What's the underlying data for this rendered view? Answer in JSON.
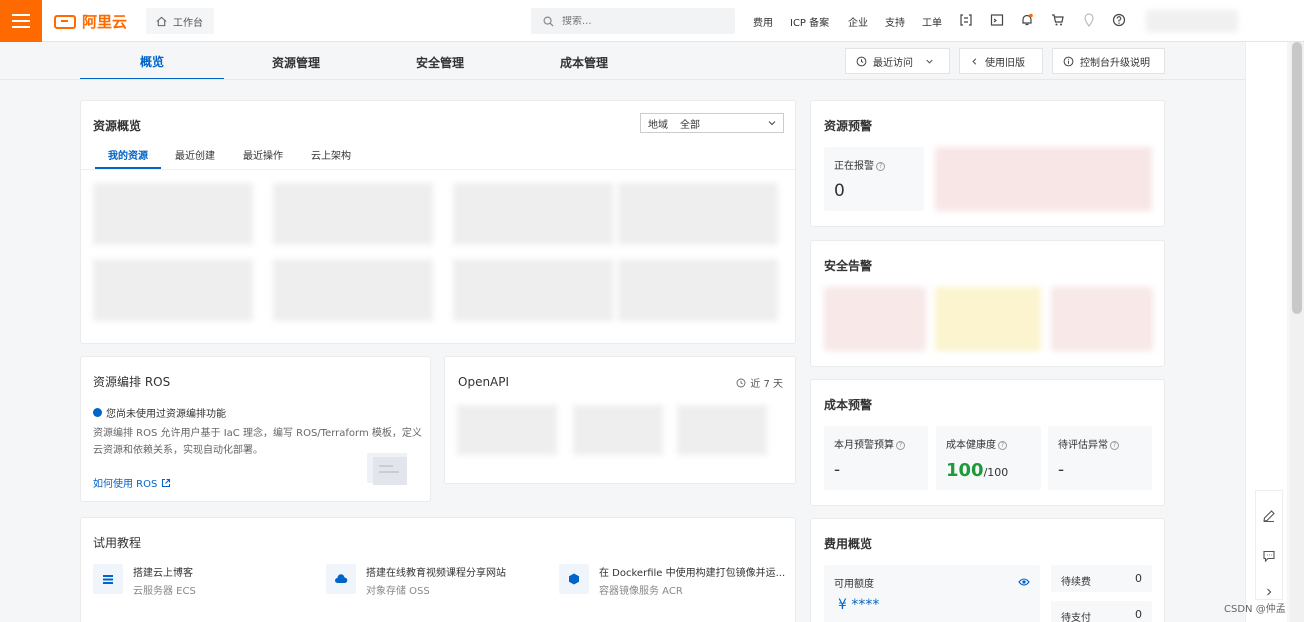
{
  "topbar": {
    "brand": "阿里云",
    "workbench": "工作台",
    "search_placeholder": "搜索...",
    "links": [
      "费用",
      "ICP 备案",
      "企业",
      "支持",
      "工单"
    ],
    "icons": [
      "bracket-icon",
      "terminal-icon",
      "bell-icon",
      "cart-icon",
      "location-icon",
      "help-icon"
    ]
  },
  "tabs": [
    "概览",
    "资源管理",
    "安全管理",
    "成本管理"
  ],
  "header_buttons": {
    "recent": "最近访问",
    "old_version": "使用旧版",
    "console_upgrade": "控制台升级说明"
  },
  "resource_overview": {
    "title": "资源概览",
    "region_label": "地域",
    "region_value": "全部",
    "subtabs": [
      "我的资源",
      "最近创建",
      "最近操作",
      "云上架构"
    ]
  },
  "ros": {
    "title": "资源编排 ROS",
    "notice": "您尚未使用过资源编排功能",
    "desc_line1": "资源编排 ROS 允许用户基于 IaC 理念，编写 ROS/Terraform 模板，定义",
    "desc_line2": "云资源和依赖关系，实现自动化部署。",
    "link": "如何使用 ROS"
  },
  "openapi": {
    "title": "OpenAPI",
    "range": "近 7 天"
  },
  "tutorials": {
    "title": "试用教程",
    "items": [
      {
        "title": "搭建云上博客",
        "sub": "云服务器 ECS"
      },
      {
        "title": "搭建在线教育视频课程分享网站",
        "sub": "对象存储 OSS"
      },
      {
        "title": "在 Dockerfile 中使用构建打包镜像并运...",
        "sub": "容器镜像服务 ACR"
      }
    ]
  },
  "resource_alert": {
    "title": "资源预警",
    "label": "正在报警",
    "value": "0"
  },
  "security_alert": {
    "title": "安全告警"
  },
  "cost_alert": {
    "title": "成本预警",
    "metrics": [
      {
        "label": "本月预警预算",
        "value": "-"
      },
      {
        "label": "成本健康度",
        "value": "100",
        "suffix": "/100"
      },
      {
        "label": "待评估异常",
        "value": "-"
      }
    ]
  },
  "fee_overview": {
    "title": "费用概览",
    "available_label": "可用额度",
    "available_value": "¥ ****",
    "pending_renew_label": "待续费",
    "pending_renew_value": "0",
    "pending_pay_label": "待支付",
    "pending_pay_value": "0"
  },
  "watermark": "CSDN @仲孟",
  "colors": {
    "brand": "#ff6a00",
    "accent": "#0064c8",
    "health": "#1f9a3a"
  }
}
